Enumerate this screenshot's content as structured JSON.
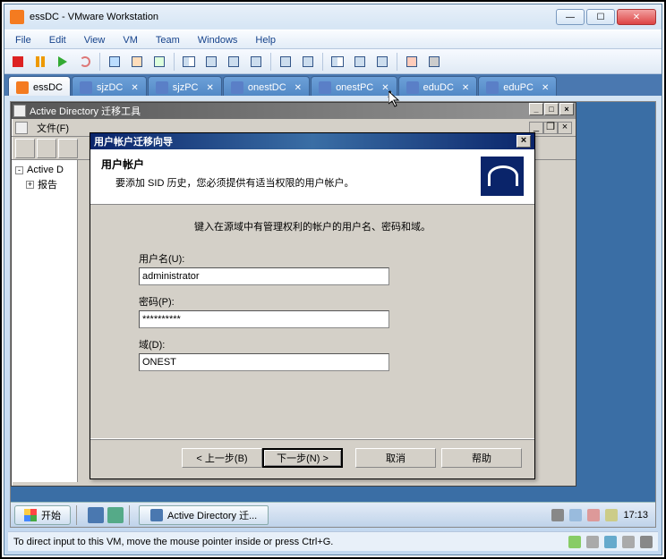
{
  "window": {
    "title": "essDC - VMware Workstation"
  },
  "menus": {
    "file": "File",
    "edit": "Edit",
    "view": "View",
    "vm": "VM",
    "team": "Team",
    "windows": "Windows",
    "help": "Help"
  },
  "vm_tabs": [
    {
      "label": "essDC",
      "active": true,
      "closable": false
    },
    {
      "label": "sjzDC",
      "active": false,
      "closable": true
    },
    {
      "label": "sjzPC",
      "active": false,
      "closable": true
    },
    {
      "label": "onestDC",
      "active": false,
      "closable": true
    },
    {
      "label": "onestPC",
      "active": false,
      "closable": true
    },
    {
      "label": "eduDC",
      "active": false,
      "closable": true
    },
    {
      "label": "eduPC",
      "active": false,
      "closable": true
    }
  ],
  "ad_window": {
    "title": "Active Directory 迁移工具",
    "menu_file": "文件(F)",
    "tree": {
      "root": "Active D",
      "child": "报告"
    }
  },
  "wizard": {
    "title": "用户帐户迁移向导",
    "heading": "用户帐户",
    "subheading": "要添加 SID 历史，您必须提供有适当权限的用户帐户。",
    "instruction": "键入在源域中有管理权利的帐户的用户名、密码和域。",
    "username_label": "用户名(U):",
    "username_value": "administrator",
    "password_label": "密码(P):",
    "password_value": "**********",
    "domain_label": "域(D):",
    "domain_value": "ONEST",
    "btn_back": "< 上一步(B)",
    "btn_next": "下一步(N) >",
    "btn_cancel": "取消",
    "btn_help": "帮助"
  },
  "taskbar": {
    "start": "开始",
    "task1": "Active Directory 迁...",
    "clock": "17:13"
  },
  "statusbar": {
    "text": "To direct input to this VM, move the mouse pointer inside or press Ctrl+G."
  }
}
